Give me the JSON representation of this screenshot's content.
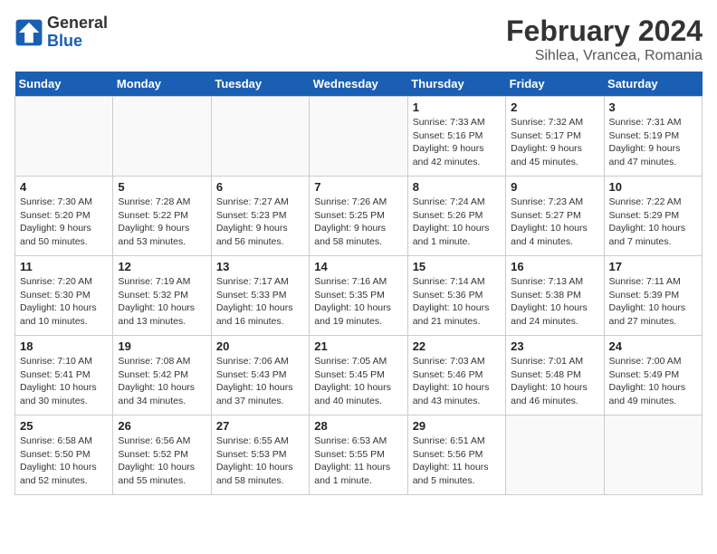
{
  "logo": {
    "text_general": "General",
    "text_blue": "Blue"
  },
  "title": "February 2024",
  "subtitle": "Sihlea, Vrancea, Romania",
  "days_of_week": [
    "Sunday",
    "Monday",
    "Tuesday",
    "Wednesday",
    "Thursday",
    "Friday",
    "Saturday"
  ],
  "weeks": [
    [
      {
        "day": "",
        "info": ""
      },
      {
        "day": "",
        "info": ""
      },
      {
        "day": "",
        "info": ""
      },
      {
        "day": "",
        "info": ""
      },
      {
        "day": "1",
        "info": "Sunrise: 7:33 AM\nSunset: 5:16 PM\nDaylight: 9 hours\nand 42 minutes."
      },
      {
        "day": "2",
        "info": "Sunrise: 7:32 AM\nSunset: 5:17 PM\nDaylight: 9 hours\nand 45 minutes."
      },
      {
        "day": "3",
        "info": "Sunrise: 7:31 AM\nSunset: 5:19 PM\nDaylight: 9 hours\nand 47 minutes."
      }
    ],
    [
      {
        "day": "4",
        "info": "Sunrise: 7:30 AM\nSunset: 5:20 PM\nDaylight: 9 hours\nand 50 minutes."
      },
      {
        "day": "5",
        "info": "Sunrise: 7:28 AM\nSunset: 5:22 PM\nDaylight: 9 hours\nand 53 minutes."
      },
      {
        "day": "6",
        "info": "Sunrise: 7:27 AM\nSunset: 5:23 PM\nDaylight: 9 hours\nand 56 minutes."
      },
      {
        "day": "7",
        "info": "Sunrise: 7:26 AM\nSunset: 5:25 PM\nDaylight: 9 hours\nand 58 minutes."
      },
      {
        "day": "8",
        "info": "Sunrise: 7:24 AM\nSunset: 5:26 PM\nDaylight: 10 hours\nand 1 minute."
      },
      {
        "day": "9",
        "info": "Sunrise: 7:23 AM\nSunset: 5:27 PM\nDaylight: 10 hours\nand 4 minutes."
      },
      {
        "day": "10",
        "info": "Sunrise: 7:22 AM\nSunset: 5:29 PM\nDaylight: 10 hours\nand 7 minutes."
      }
    ],
    [
      {
        "day": "11",
        "info": "Sunrise: 7:20 AM\nSunset: 5:30 PM\nDaylight: 10 hours\nand 10 minutes."
      },
      {
        "day": "12",
        "info": "Sunrise: 7:19 AM\nSunset: 5:32 PM\nDaylight: 10 hours\nand 13 minutes."
      },
      {
        "day": "13",
        "info": "Sunrise: 7:17 AM\nSunset: 5:33 PM\nDaylight: 10 hours\nand 16 minutes."
      },
      {
        "day": "14",
        "info": "Sunrise: 7:16 AM\nSunset: 5:35 PM\nDaylight: 10 hours\nand 19 minutes."
      },
      {
        "day": "15",
        "info": "Sunrise: 7:14 AM\nSunset: 5:36 PM\nDaylight: 10 hours\nand 21 minutes."
      },
      {
        "day": "16",
        "info": "Sunrise: 7:13 AM\nSunset: 5:38 PM\nDaylight: 10 hours\nand 24 minutes."
      },
      {
        "day": "17",
        "info": "Sunrise: 7:11 AM\nSunset: 5:39 PM\nDaylight: 10 hours\nand 27 minutes."
      }
    ],
    [
      {
        "day": "18",
        "info": "Sunrise: 7:10 AM\nSunset: 5:41 PM\nDaylight: 10 hours\nand 30 minutes."
      },
      {
        "day": "19",
        "info": "Sunrise: 7:08 AM\nSunset: 5:42 PM\nDaylight: 10 hours\nand 34 minutes."
      },
      {
        "day": "20",
        "info": "Sunrise: 7:06 AM\nSunset: 5:43 PM\nDaylight: 10 hours\nand 37 minutes."
      },
      {
        "day": "21",
        "info": "Sunrise: 7:05 AM\nSunset: 5:45 PM\nDaylight: 10 hours\nand 40 minutes."
      },
      {
        "day": "22",
        "info": "Sunrise: 7:03 AM\nSunset: 5:46 PM\nDaylight: 10 hours\nand 43 minutes."
      },
      {
        "day": "23",
        "info": "Sunrise: 7:01 AM\nSunset: 5:48 PM\nDaylight: 10 hours\nand 46 minutes."
      },
      {
        "day": "24",
        "info": "Sunrise: 7:00 AM\nSunset: 5:49 PM\nDaylight: 10 hours\nand 49 minutes."
      }
    ],
    [
      {
        "day": "25",
        "info": "Sunrise: 6:58 AM\nSunset: 5:50 PM\nDaylight: 10 hours\nand 52 minutes."
      },
      {
        "day": "26",
        "info": "Sunrise: 6:56 AM\nSunset: 5:52 PM\nDaylight: 10 hours\nand 55 minutes."
      },
      {
        "day": "27",
        "info": "Sunrise: 6:55 AM\nSunset: 5:53 PM\nDaylight: 10 hours\nand 58 minutes."
      },
      {
        "day": "28",
        "info": "Sunrise: 6:53 AM\nSunset: 5:55 PM\nDaylight: 11 hours\nand 1 minute."
      },
      {
        "day": "29",
        "info": "Sunrise: 6:51 AM\nSunset: 5:56 PM\nDaylight: 11 hours\nand 5 minutes."
      },
      {
        "day": "",
        "info": ""
      },
      {
        "day": "",
        "info": ""
      }
    ]
  ]
}
